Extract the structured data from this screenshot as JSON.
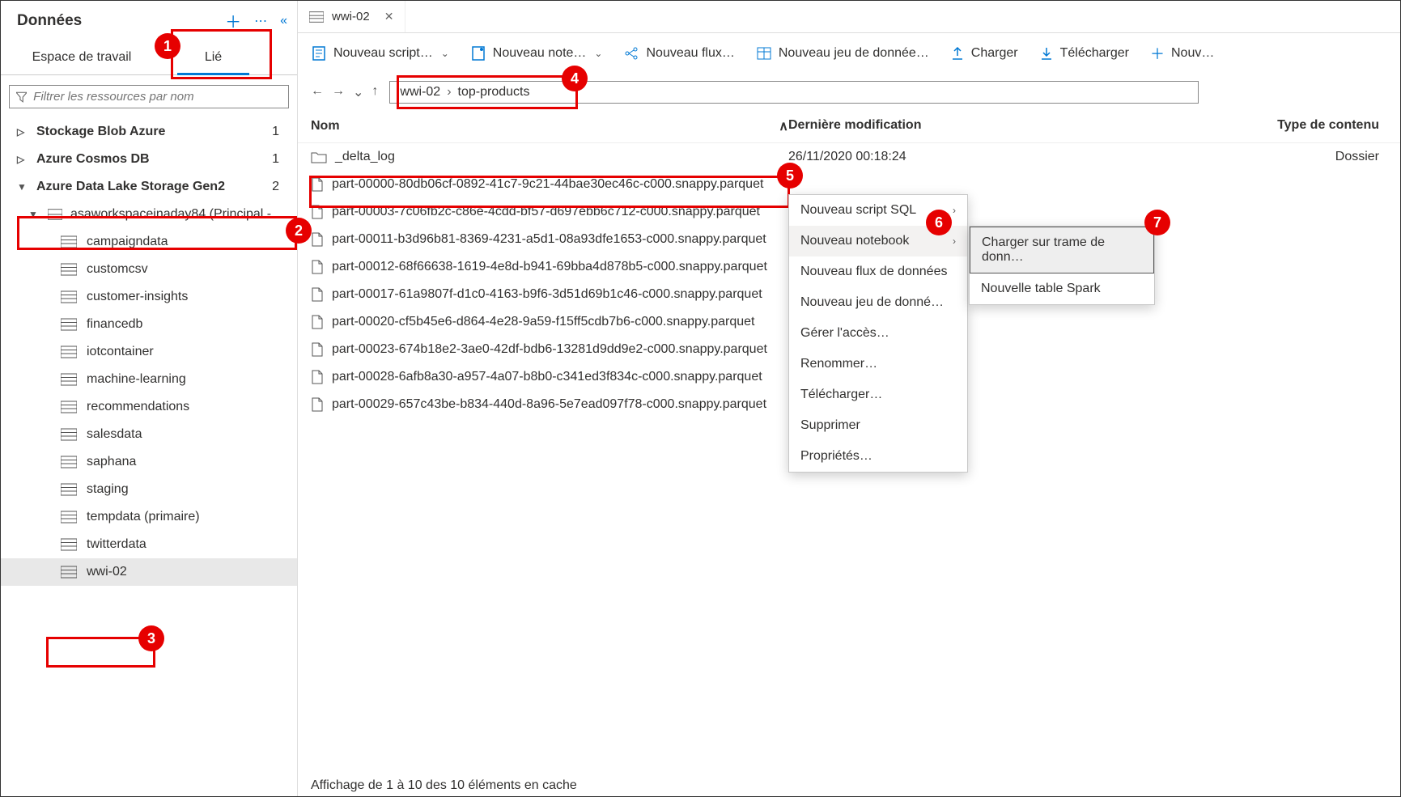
{
  "sidebar": {
    "title": "Données",
    "tabs": {
      "workspace": "Espace de travail",
      "linked": "Lié"
    },
    "filter_placeholder": "Filtrer les ressources par nom",
    "groups": [
      {
        "label": "Stockage Blob Azure",
        "count": "1"
      },
      {
        "label": "Azure Cosmos DB",
        "count": "1"
      },
      {
        "label": "Azure Data Lake Storage Gen2",
        "count": "2"
      }
    ],
    "account": "asaworkspaceinaday84 (Principal - …",
    "containers": [
      "campaigndata",
      "customcsv",
      "customer-insights",
      "financedb",
      "iotcontainer",
      "machine-learning",
      "recommendations",
      "salesdata",
      "saphana",
      "staging",
      "tempdata (primaire)",
      "twitterdata",
      "wwi-02"
    ]
  },
  "main": {
    "tab_title": "wwi-02",
    "toolbar": {
      "new_script": "Nouveau script…",
      "new_notebook": "Nouveau note…",
      "new_flow": "Nouveau flux…",
      "new_dataset": "Nouveau jeu de donnée…",
      "upload": "Charger",
      "download": "Télécharger",
      "new_folder": "Nouv…"
    },
    "breadcrumb": {
      "root": "wwi-02",
      "folder": "top-products"
    },
    "columns": {
      "name": "Nom",
      "modified": "Dernière modification",
      "type": "Type de contenu"
    },
    "rows": [
      {
        "kind": "folder",
        "name": "_delta_log",
        "modified": "26/11/2020 00:18:24",
        "type": "Dossier"
      },
      {
        "kind": "file",
        "name": "part-00000-80db06cf-0892-41c7-9c21-44bae30ec46c-c000.snappy.parquet"
      },
      {
        "kind": "file",
        "name": "part-00003-7c06fb2c-c86e-4cdd-bf57-d697ebb6c712-c000.snappy.parquet"
      },
      {
        "kind": "file",
        "name": "part-00011-b3d96b81-8369-4231-a5d1-08a93dfe1653-c000.snappy.parquet"
      },
      {
        "kind": "file",
        "name": "part-00012-68f66638-1619-4e8d-b941-69bba4d878b5-c000.snappy.parquet"
      },
      {
        "kind": "file",
        "name": "part-00017-61a9807f-d1c0-4163-b9f6-3d51d69b1c46-c000.snappy.parquet"
      },
      {
        "kind": "file",
        "name": "part-00020-cf5b45e6-d864-4e28-9a59-f15ff5cdb7b6-c000.snappy.parquet"
      },
      {
        "kind": "file",
        "name": "part-00023-674b18e2-3ae0-42df-bdb6-13281d9dd9e2-c000.snappy.parquet"
      },
      {
        "kind": "file",
        "name": "part-00028-6afb8a30-a957-4a07-b8b0-c341ed3f834c-c000.snappy.parquet"
      },
      {
        "kind": "file",
        "name": "part-00029-657c43be-b834-440d-8a96-5e7ead097f78-c000.snappy.parquet"
      }
    ],
    "status": "Affichage de 1 à 10 des 10 éléments en cache"
  },
  "ctx": {
    "items": [
      "Nouveau script SQL",
      "Nouveau notebook",
      "Nouveau flux de données",
      "Nouveau jeu de donné…",
      "Gérer l'accès…",
      "Renommer…",
      "Télécharger…",
      "Supprimer",
      "Propriétés…"
    ],
    "sub": [
      "Charger sur trame de donn…",
      "Nouvelle table Spark"
    ]
  },
  "callouts": {
    "c1": "1",
    "c2": "2",
    "c3": "3",
    "c4": "4",
    "c5": "5",
    "c6": "6",
    "c7": "7"
  }
}
